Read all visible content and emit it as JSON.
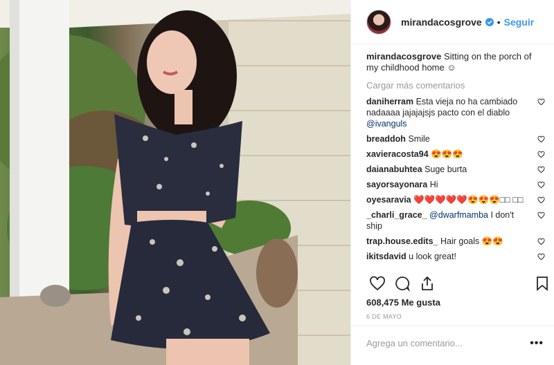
{
  "header": {
    "username": "mirandacosgrove",
    "separator": "•",
    "follow_label": "Seguir"
  },
  "caption": {
    "username": "mirandacosgrove",
    "text": "Sitting on the porch of my childhood home ☺"
  },
  "load_more": "Cargar más comentarios",
  "comments": [
    {
      "user": "daniherram",
      "text": "Esta vieja no ha cambiado nadaaaa jajajajsjs pacto con el diablo ",
      "mention": "@ivanguls"
    },
    {
      "user": "breaddoh",
      "text": "Smile",
      "mention": ""
    },
    {
      "user": "xavieracosta94",
      "text": "😍😍😍",
      "mention": ""
    },
    {
      "user": "daianabuhtea",
      "text": "Suge burta",
      "mention": ""
    },
    {
      "user": "sayorsayonara",
      "text": "Hi",
      "mention": ""
    },
    {
      "user": "oyesaravia",
      "text": "❤️❤️❤️❤️❤️😍😍😍□□ □□",
      "mention": ""
    },
    {
      "user": "_charli_grace_",
      "text": " I don't ship",
      "mention": "@dwarfmamba"
    },
    {
      "user": "trap.house.edits_",
      "text": "Hair goals 😍😍",
      "mention": ""
    },
    {
      "user": "ikitsdavid",
      "text": "u look great!",
      "mention": ""
    }
  ],
  "likes": "608,475 Me gusta",
  "date": "6 DE MAYO",
  "add_comment": {
    "placeholder": "Agrega un comentario..."
  },
  "more_options": "•••",
  "icons": {
    "verified": "verified-badge-icon",
    "heart": "heart-icon",
    "comment": "comment-bubble-icon",
    "share": "share-icon",
    "bookmark": "bookmark-icon"
  },
  "colors": {
    "accent": "#3897f0",
    "mention": "#003569",
    "muted": "#999999"
  }
}
